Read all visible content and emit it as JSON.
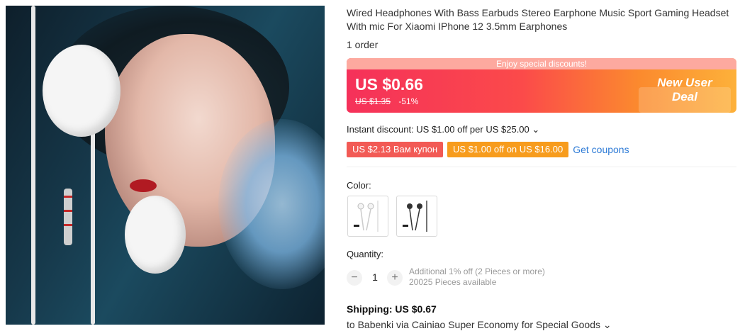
{
  "product": {
    "title": "Wired Headphones With Bass Earbuds Stereo Earphone Music Sport Gaming Headset With mic For Xiaomi IPhone 12 3.5mm Earphones",
    "orders": "1 order"
  },
  "price": {
    "banner_top": "Enjoy special discounts!",
    "current": "US $0.66",
    "original": "US $1.35",
    "discount": "-51%",
    "badge_line1": "New User",
    "badge_line2": "Deal"
  },
  "promo": {
    "instant": "Instant discount: US $1.00 off per US $25.00",
    "coupon1": "US $2.13 Вам купон",
    "coupon2": "US $1.00 off on US $16.00",
    "get_coupons": "Get coupons"
  },
  "color": {
    "label": "Color:"
  },
  "quantity": {
    "label": "Quantity:",
    "value": "1",
    "minus": "−",
    "plus": "+",
    "note_line1": "Additional 1% off (2 Pieces or more)",
    "note_line2": "20025 Pieces available"
  },
  "shipping": {
    "label": "Shipping: US $0.67",
    "to": "to Babenki via Cainiao Super Economy for Special Goods"
  },
  "icons": {
    "chevron": "chevron-down-icon"
  },
  "colors": {
    "accent_red": "#f5315a",
    "accent_orange": "#f79c1d",
    "link_blue": "#2e7bd6"
  }
}
